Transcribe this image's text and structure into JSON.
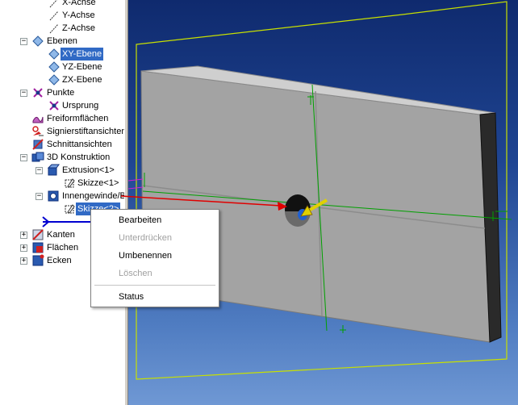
{
  "tree": {
    "items": [
      {
        "label": "X-Achse",
        "level": 3
      },
      {
        "label": "Y-Achse",
        "level": 3
      },
      {
        "label": "Z-Achse",
        "level": 3
      },
      {
        "label": "Ebenen",
        "level": 1,
        "expander": "−"
      },
      {
        "label": "XY-Ebene",
        "level": 2,
        "selected": true
      },
      {
        "label": "YZ-Ebene",
        "level": 2
      },
      {
        "label": "ZX-Ebene",
        "level": 2
      },
      {
        "label": "Punkte",
        "level": 1,
        "expander": "−"
      },
      {
        "label": "Ursprung",
        "level": 2
      },
      {
        "label": "Freiformflächen",
        "level": 1
      },
      {
        "label": "Signierstiftansichten",
        "level": 1
      },
      {
        "label": "Schnittansichten",
        "level": 1
      },
      {
        "label": "3D Konstruktion",
        "level": 1,
        "expander": "−"
      },
      {
        "label": "Extrusion<1>",
        "level": 2,
        "expander": "−"
      },
      {
        "label": "Skizze<1>",
        "level": 3
      },
      {
        "label": "Innengewinde/B",
        "level": 2,
        "expander": "−"
      },
      {
        "label": "Skizze<2>",
        "level": 3,
        "selected": true
      },
      {
        "label": "Kanten",
        "level": 1,
        "expander": "+"
      },
      {
        "label": "Flächen",
        "level": 1,
        "expander": "+"
      },
      {
        "label": "Ecken",
        "level": 1,
        "expander": "+"
      }
    ]
  },
  "context_menu": {
    "items": [
      {
        "label": "Bearbeiten",
        "enabled": true
      },
      {
        "label": "Unterdrücken",
        "enabled": false
      },
      {
        "label": "Umbenennen",
        "enabled": true
      },
      {
        "label": "Löschen",
        "enabled": false
      },
      {
        "label": "Status",
        "enabled": true
      }
    ]
  },
  "colors": {
    "selection": "#316ac5",
    "viewport_top": "#0f2a6e",
    "viewport_bottom": "#6f98d4",
    "wire_frame": "#c8e000",
    "plane_outline": "#d020d0",
    "axis_green": "#00a000",
    "callout_arrow": "#e00000",
    "thread_arrow": "#e0d000"
  },
  "icons": {
    "axis": "axis-icon",
    "plane": "plane-icon",
    "point": "point-icon",
    "freeform": "freeform-surface-icon",
    "markup": "markup-pen-icon",
    "section": "section-view-icon",
    "construction": "3d-construction-icon",
    "extrusion": "extrusion-icon",
    "thread": "thread-icon",
    "sketch": "sketch-icon",
    "edges": "edges-icon",
    "faces": "faces-icon",
    "vertices": "vertices-icon"
  }
}
